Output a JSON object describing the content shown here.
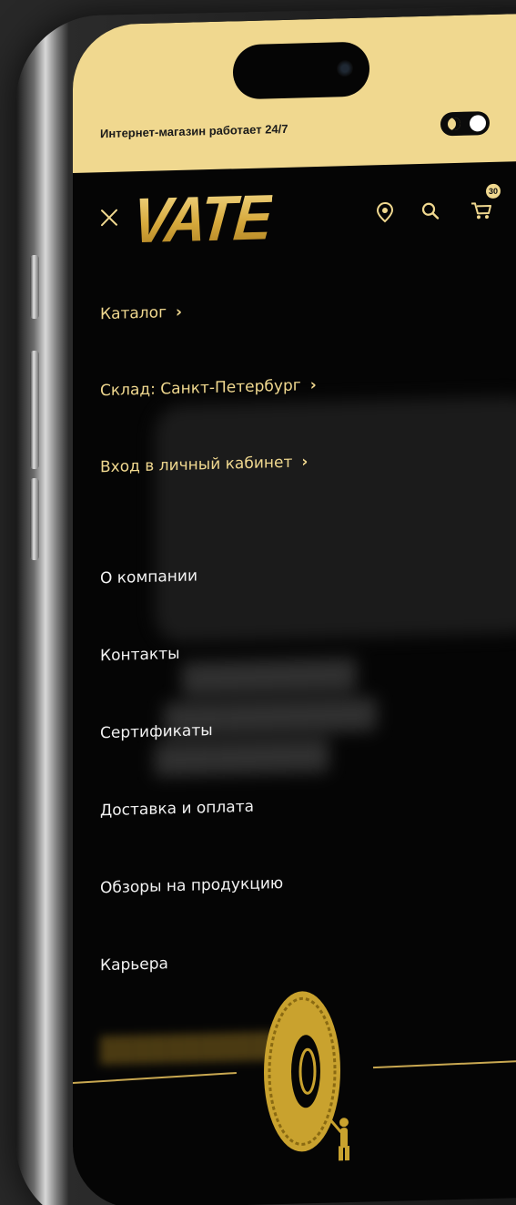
{
  "status_bar": {
    "text": "Интернет-магазин работает 24/7"
  },
  "header": {
    "logo": "VATE",
    "cart_count": "30"
  },
  "menu": {
    "primary": [
      {
        "label": "Каталог"
      },
      {
        "label": "Склад: Санкт-Петербург"
      },
      {
        "label": "Вход в личный кабинет"
      }
    ],
    "secondary": [
      {
        "label": "О компании"
      },
      {
        "label": "Контакты"
      },
      {
        "label": "Сертификаты"
      },
      {
        "label": "Доставка и оплата"
      },
      {
        "label": "Обзоры на продукцию"
      },
      {
        "label": "Карьера"
      }
    ]
  },
  "colors": {
    "accent": "#f0d88f",
    "background": "#050505",
    "text_light": "#f2f2f2"
  },
  "icons": [
    "close-icon",
    "location-pin-icon",
    "search-icon",
    "cart-icon",
    "moon-icon",
    "chevron-right-icon",
    "tire-illustration"
  ]
}
